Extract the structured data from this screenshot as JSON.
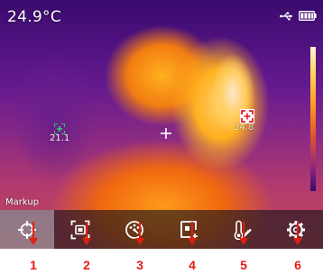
{
  "header": {
    "temperature": "24.9°C",
    "status_icons": [
      "usb-icon",
      "battery-icon"
    ]
  },
  "thermal_view": {
    "palette_scale_icon": "color-scale-bar",
    "markers": [
      {
        "name": "cold-spot",
        "color": "#22e06a",
        "value": "21.1"
      },
      {
        "name": "hot-spot",
        "color": "#e8202a",
        "value": "34.8"
      }
    ],
    "center_crosshair_icon": "crosshair-icon",
    "mode_label": "Markup"
  },
  "toolbar": {
    "items": [
      {
        "icon": "target-icon",
        "selected": true
      },
      {
        "icon": "screen-capture-icon",
        "selected": false
      },
      {
        "icon": "palette-icon",
        "selected": false
      },
      {
        "icon": "measurement-area-icon",
        "selected": false
      },
      {
        "icon": "thermometer-icon",
        "selected": false
      },
      {
        "icon": "settings-gear-icon",
        "selected": false
      }
    ]
  },
  "callouts": {
    "color": "#e21e10",
    "numbers": [
      "1",
      "2",
      "3",
      "4",
      "5",
      "6"
    ]
  }
}
